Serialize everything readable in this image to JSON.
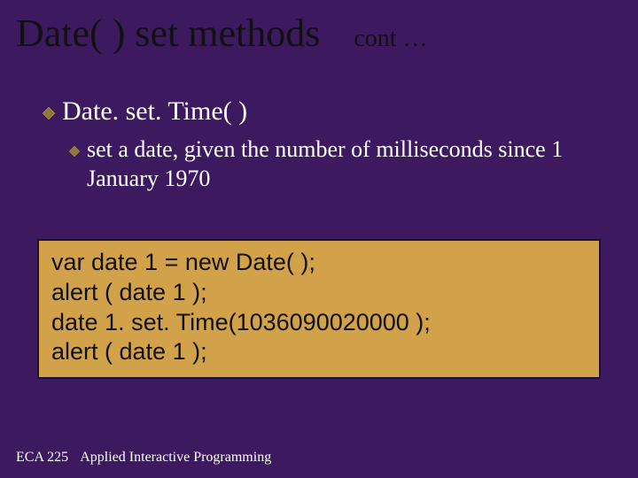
{
  "title": "Date( ) set methods",
  "cont": "cont …",
  "method": {
    "name": "Date. set. Time( )",
    "desc": "set a date, given the number of milliseconds since 1 January 1970"
  },
  "code": {
    "line1": "var date 1 = new Date( );",
    "line2": "alert ( date 1 );",
    "line3": "date 1. set. Time(1036090020000 );",
    "line4": "alert ( date 1 );"
  },
  "footer": {
    "course_code": "ECA 225",
    "course_title": "Applied Interactive Programming"
  },
  "colors": {
    "background": "#3d1a5f",
    "title_text": "#111111",
    "body_text": "#ffffff",
    "codebox_bg": "#d2a24a",
    "codebox_border": "#1b0f33"
  }
}
